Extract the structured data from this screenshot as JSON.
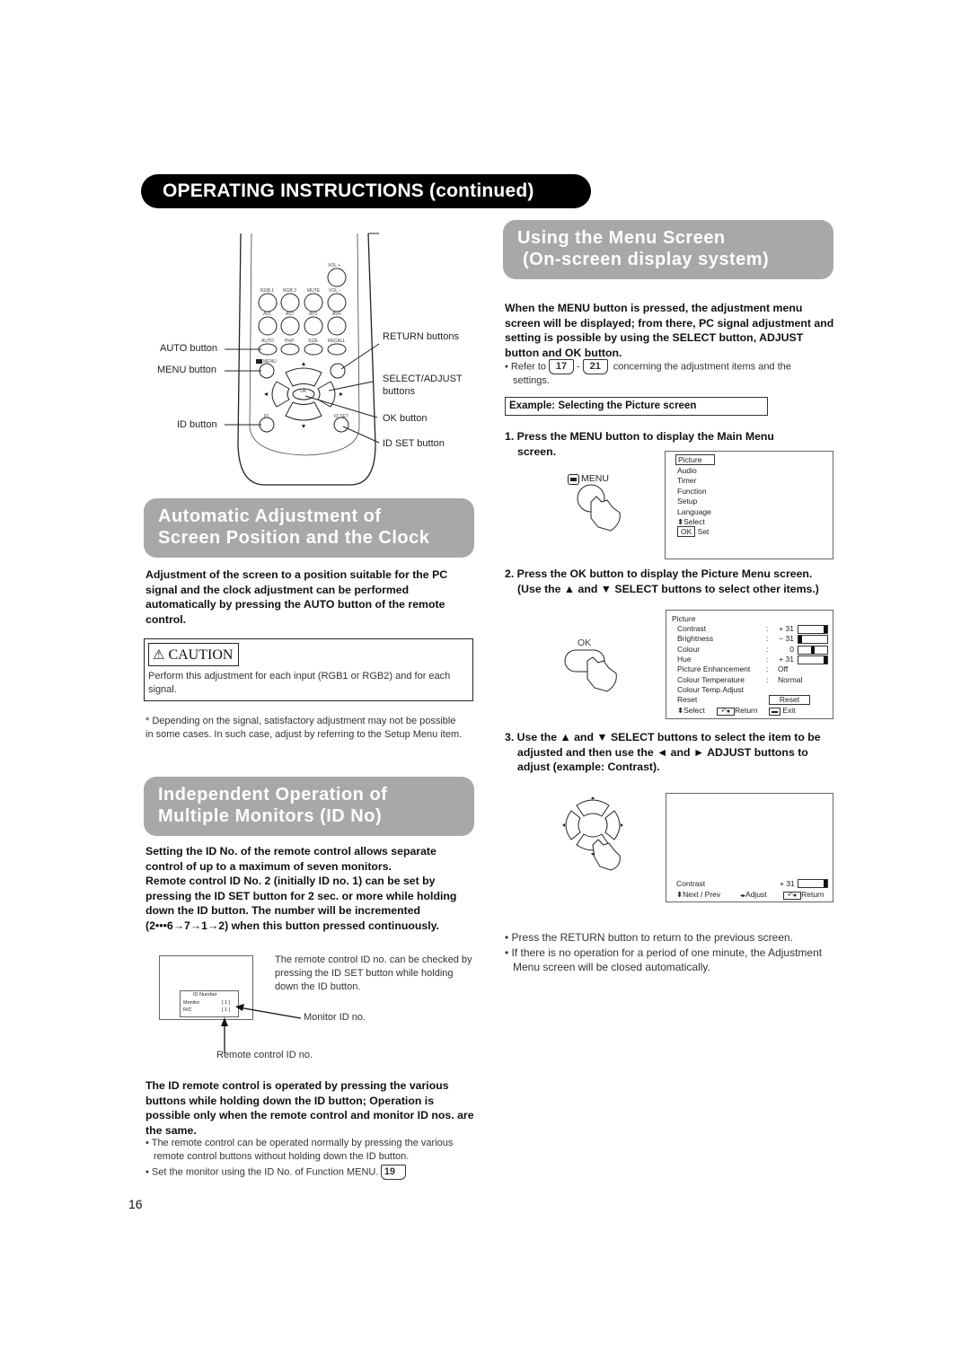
{
  "page": {
    "header": "OPERATING INSTRUCTIONS (continued)",
    "page_number": "16"
  },
  "remote": {
    "button_labels": {
      "vol_plus": "VOL +",
      "rgb1": "RGB 1",
      "rgb2": "RGB 2",
      "mute": "MUTE",
      "vol_minus": "VOL −",
      "av1": "AV1",
      "av2": "AV2",
      "av3": "AV3",
      "av4": "AV4",
      "auto": "AUTO",
      "pinp": "PinP",
      "size": "SIZE",
      "recall": "RECALL",
      "menu": "MENU",
      "ok": "OK",
      "id": "ID",
      "id_set": "ID SET"
    },
    "callouts": {
      "auto": "AUTO button",
      "menu": "MENU button",
      "id": "ID button",
      "return": "RETURN buttons",
      "select_adjust_1": "SELECT/ADJUST",
      "select_adjust_2": "buttons",
      "ok": "OK button",
      "id_set": "ID SET button"
    }
  },
  "auto_section": {
    "title_line1": "Automatic Adjustment of",
    "title_line2": "Screen Position and the Clock",
    "intro": "Adjustment of the screen to a position suitable for the PC signal and the clock adjustment can be performed automatically by pressing the AUTO button of the remote control.",
    "caution_label": "CAUTION",
    "caution_text": "Perform this adjustment for each input (RGB1 or RGB2) and for each signal.",
    "note": "* Depending on the signal, satisfactory adjustment may not be possible in some cases. In such case, adjust by referring to the Setup Menu item."
  },
  "id_section": {
    "title_line1": "Independent Operation of",
    "title_line2": "Multiple Monitors (ID No)",
    "intro_line1": "Setting the ID No. of the remote control allows separate control of up to a maximum of seven monitors.",
    "intro_line2": "Remote control ID No. 2 (initially ID no. 1) can be set by pressing the ID SET button for 2 sec. or more while holding down the ID button.  The number will be incremented (2•••6→7→1→2) when this button pressed continuously.",
    "osd": {
      "title": "ID Number",
      "monitor_label": "Monitor",
      "monitor_value": "[ 1 ]",
      "rc_label": "R/C",
      "rc_value": "[ 1 ]"
    },
    "check_text": "The remote control ID no. can be checked by pressing the ID SET button while holding down the ID button.",
    "monitor_callout": "Monitor ID no.",
    "remote_callout": "Remote control ID no.",
    "operation_text": "The ID remote control is operated by pressing the various buttons while holding down the ID button; Operation is possible only when the remote control and monitor ID nos. are the same.",
    "bullets": [
      "The remote control can be operated normally by pressing the various remote control buttons without holding down the ID button.",
      "Set the monitor using the ID No. of Function MENU."
    ],
    "ref_page": "19"
  },
  "menu_section": {
    "title_line1": "Using the Menu Screen",
    "title_line2": "(On-screen display system)",
    "intro": "When the MENU button is pressed, the adjustment menu screen will be displayed; from there, PC signal adjustment and setting is possible by using the SELECT button, ADJUST button and OK button.",
    "refer_prefix": "• Refer to",
    "ref_from": "17",
    "ref_dash": "-",
    "ref_to": "21",
    "refer_suffix": "concerning the adjustment items and the",
    "refer_suffix2": "settings.",
    "example_label": "Example: Selecting the Picture screen",
    "step1": "1. Press the MENU button to display the Main Menu screen.",
    "step1_button": "MENU",
    "main_menu": {
      "items": [
        "Picture",
        "Audio",
        "Timer",
        "Function",
        "Setup",
        "Language"
      ],
      "select_hint": "Select",
      "ok_label": "OK",
      "set_label": "Set"
    },
    "step2": "2. Press the OK button to display the Picture Menu screen. (Use the ▲ and ▼ SELECT buttons to select other items.)",
    "step2_button": "OK",
    "picture_menu": {
      "title": "Picture",
      "rows": [
        {
          "label": "Contrast",
          "value": "+ 31",
          "level": 1.0
        },
        {
          "label": "Brightness",
          "value": "− 31",
          "level": 0.0
        },
        {
          "label": "Colour",
          "value": "0",
          "level": 0.5
        },
        {
          "label": "Hue",
          "value": "+ 31",
          "level": 1.0
        },
        {
          "label": "Picture Enhancement",
          "value": "Off"
        },
        {
          "label": "Colour Temperature",
          "value": "Normal"
        },
        {
          "label": "Colour Temp.Adjust",
          "value": ""
        },
        {
          "label": "Reset",
          "value": ""
        }
      ],
      "reset_button": "Reset",
      "select_hint": "Select",
      "return_hint": "Return",
      "exit_hint": "Exit"
    },
    "step3": "3. Use the ▲ and ▼ SELECT buttons to select the item to be adjusted and then use the ◄ and ► ADJUST buttons to adjust (example: Contrast).",
    "adjust_screen": {
      "label": "Contrast",
      "value": "+ 31",
      "level": 1.0,
      "next_prev": "Next / Prev",
      "adjust": "Adjust",
      "return": "Return"
    },
    "bullets": [
      "Press the RETURN button to return to the previous screen.",
      "If there is no operation for a period of one minute, the Adjustment Menu screen will be closed automatically."
    ]
  }
}
